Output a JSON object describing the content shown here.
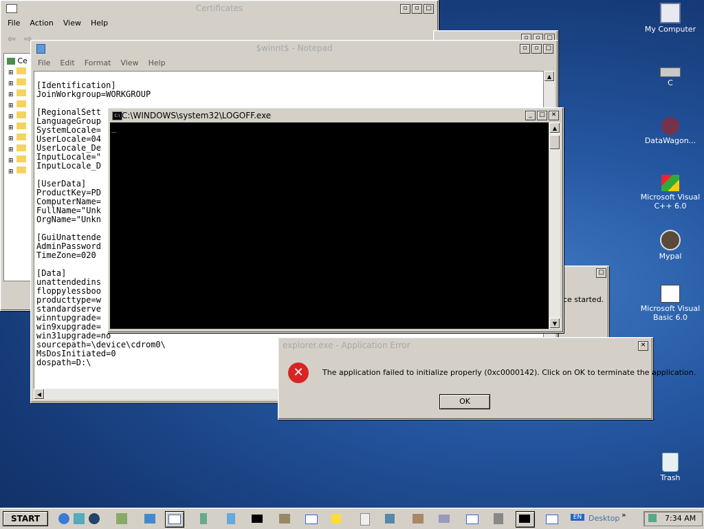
{
  "cert_window": {
    "title": "Certificates",
    "menu": [
      "File",
      "Action",
      "View",
      "Help"
    ],
    "tree_root": "Ce"
  },
  "notepad": {
    "title": "$winnt$ - Notepad",
    "menu": [
      "File",
      "Edit",
      "Format",
      "View",
      "Help"
    ],
    "lines": [
      "[Identification]",
      "JoinWorkgroup=WORKGROUP",
      "",
      "[RegionalSett",
      "LanguageGroup",
      "SystemLocale=",
      "UserLocale=04",
      "UserLocale_De",
      "InputLocale=\"",
      "InputLocale_D",
      "",
      "[UserData]",
      "ProductKey=PD",
      "ComputerName=",
      "FullName=\"Unk",
      "OrgName=\"Unkn",
      "",
      "[GuiUnattende",
      "AdminPassword",
      "TimeZone=020",
      "",
      "[Data]",
      "unattendedins",
      "floppylessboo",
      "producttype=w",
      "standardserve",
      "winntupgrade=",
      "win9xupgrade=",
      "win31upgrade=no",
      "sourcepath=\\device\\cdrom0\\",
      "MsDosInitiated=0",
      "dospath=D:\\"
    ]
  },
  "console": {
    "title": "C:\\WINDOWS\\system32\\LOGOFF.exe",
    "cursor": "_"
  },
  "service_window": {
    "text": "ce started."
  },
  "error_dialog": {
    "title": "explorer.exe - Application Error",
    "message": "The application failed to initialize properly (0xc0000142). Click on OK to terminate the application.",
    "ok_label": "OK"
  },
  "desktop_icons": [
    {
      "label": "My Computer",
      "icon": "my-computer-icon"
    },
    {
      "label": "C",
      "icon": "drive-icon"
    },
    {
      "label": "DataWagon...",
      "icon": "datawagon-icon"
    },
    {
      "label": "Microsoft Visual C++ 6.0",
      "icon": "visual-cpp-icon"
    },
    {
      "label": "Mypal",
      "icon": "mypal-icon"
    },
    {
      "label": "Microsoft Visual Basic 6.0",
      "icon": "visual-basic-icon"
    },
    {
      "label": "Trash",
      "icon": "trash-icon"
    }
  ],
  "taskbar": {
    "start_label": "START",
    "desktop_label": "Desktop",
    "chevron": "»",
    "clock": "7:34 AM",
    "lang": "EN"
  }
}
